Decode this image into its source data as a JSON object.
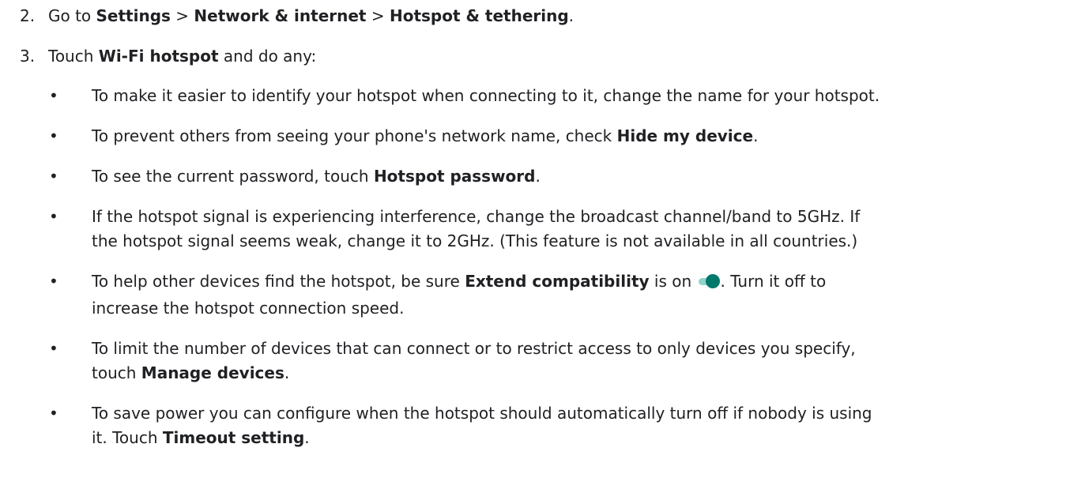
{
  "steps": [
    {
      "number": "2.",
      "parts": [
        "Go to ",
        "Settings",
        " > ",
        "Network & internet",
        " > ",
        "Hotspot & tethering",
        "."
      ]
    },
    {
      "number": "3.",
      "parts": [
        "Touch ",
        "Wi-Fi hotspot",
        " and do any:"
      ]
    }
  ],
  "bullets": [
    {
      "marker": "•",
      "line1": "To make it easier to identify your hotspot when connecting to it, change the name for your hotspot."
    },
    {
      "marker": "•",
      "pre": "To prevent others from seeing your phone's network name, check ",
      "bold": "Hide my device",
      "post": "."
    },
    {
      "marker": "•",
      "pre": "To see the current password, touch ",
      "bold": "Hotspot password",
      "post": "."
    },
    {
      "marker": "•",
      "line1": "If the hotspot signal is experiencing interference, change the broadcast channel/band to 5GHz. If",
      "line2": "the hotspot signal seems weak, change it to 2GHz. (This feature is not available in all countries.)"
    },
    {
      "marker": "•",
      "pre": "To help other devices find the hotspot, be sure ",
      "bold": "Extend compatibility",
      "mid": " is on ",
      "post": ". Turn it off to",
      "line2": "increase the hotspot connection speed."
    },
    {
      "marker": "•",
      "line1": "To limit the number of devices that can connect or to restrict access to only devices you specify,",
      "pre2": "touch ",
      "bold2": "Manage devices",
      "post2": "."
    },
    {
      "marker": "•",
      "line1": "To save power you can configure when the hotspot should automatically turn off if nobody is using",
      "pre2": "it. Touch ",
      "bold2": "Timeout setting",
      "post2": "."
    }
  ],
  "colors": {
    "text": "#202124",
    "toggle_track": "#8fd3cb",
    "toggle_knob": "#00796b"
  }
}
